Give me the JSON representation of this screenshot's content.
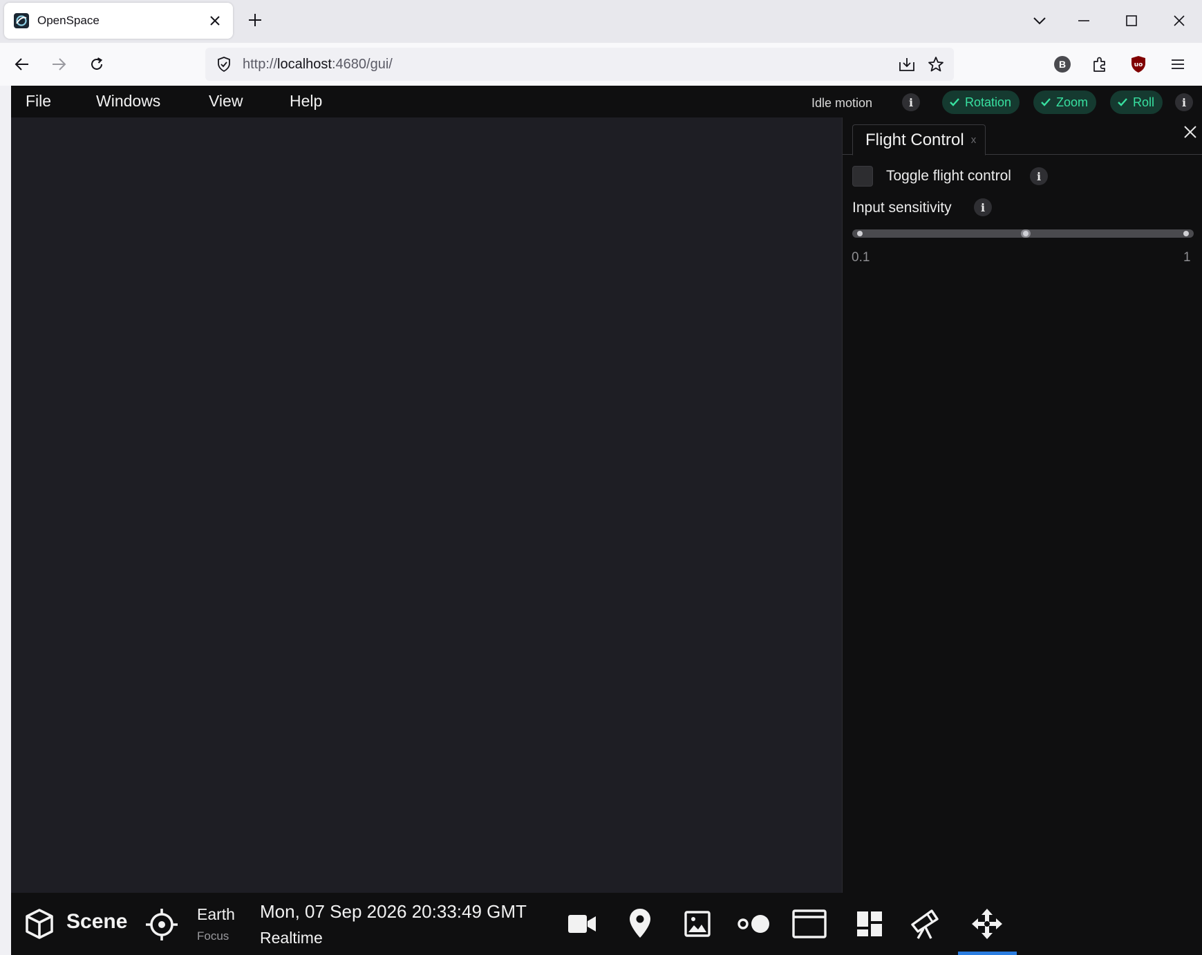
{
  "browser": {
    "tab_title": "OpenSpace",
    "url_scheme": "http://",
    "url_host": "localhost",
    "url_rest": ":4680/gui/",
    "profile_badge": "B"
  },
  "menu": {
    "items": [
      "File",
      "Windows",
      "View",
      "Help"
    ],
    "idle_motion_label": "Idle motion",
    "pills": [
      "Rotation",
      "Zoom",
      "Roll"
    ],
    "info_glyph": "i"
  },
  "panel": {
    "tab_label": "Flight Control",
    "tab_close": "x",
    "toggle_label": "Toggle flight control",
    "toggle_checked": false,
    "sensitivity_label": "Input sensitivity",
    "slider_min": "0.1",
    "slider_max": "1"
  },
  "bottom": {
    "scene_label": "Scene",
    "focus_name": "Earth",
    "focus_sub": "Focus",
    "time": "Mon, 07 Sep 2026 20:33:49 GMT",
    "time_mode": "Realtime"
  },
  "colors": {
    "accent_green": "#38e0a0",
    "pill_bg": "#153a30",
    "active_blue": "#2b7de0",
    "viewport_bg": "#1e1e24",
    "bar_bg": "#0f0f10"
  }
}
